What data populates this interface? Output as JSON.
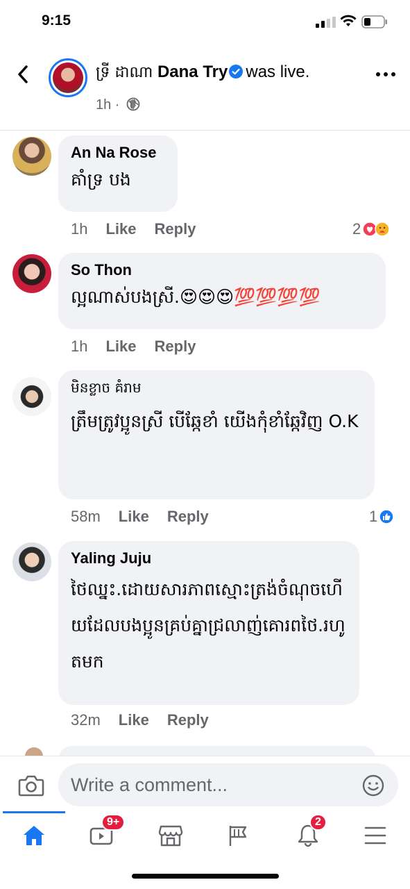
{
  "status_bar": {
    "time": "9:15"
  },
  "header": {
    "khmer_name": "ទ្រី ដាណា",
    "name": "Dana Try",
    "suffix": "was live.",
    "time": "1h ·"
  },
  "comments": [
    {
      "name": "An Na Rose",
      "text": "គាំទ្រ បង",
      "time": "1h",
      "like": "Like",
      "reply": "Reply",
      "reaction_count": "2"
    },
    {
      "name": "So Thon",
      "text": "ល្អណាស់បងស្រី.😍😍😍💯💯💯💯",
      "time": "1h",
      "like": "Like",
      "reply": "Reply"
    },
    {
      "name": "មិនខ្លាច គំរាម",
      "text": "ត្រឹមត្រូវប្អូនស្រី បើឆ្កែខាំ យើងកុំខាំឆ្កែវិញ O.K",
      "time": "58m",
      "like": "Like",
      "reply": "Reply",
      "reaction_count": "1"
    },
    {
      "name": "Yaling Juju",
      "text": "ថៃឈ្នះ.ដោយសារភាពស្មោះត្រង់ចំណុចហើយដែលបងប្អូនគ្រប់គ្នាជ្រលាញ់គោរពថៃ.រហូតមក",
      "time": "32m",
      "like": "Like",
      "reply": "Reply"
    }
  ],
  "composer": {
    "placeholder": "Write a comment..."
  },
  "tabbar": {
    "watch_badge": "9+",
    "notifications_badge": "2"
  },
  "colors": {
    "accent": "#1877f2",
    "badge": "#e41e3f",
    "bubble": "#f0f2f5"
  },
  "icons": [
    "back-arrow-icon",
    "verified-icon",
    "globe-icon",
    "more-icon",
    "camera-icon",
    "emoji-icon",
    "home-icon",
    "watch-icon",
    "marketplace-icon",
    "flag-icon",
    "bell-icon",
    "menu-icon"
  ]
}
